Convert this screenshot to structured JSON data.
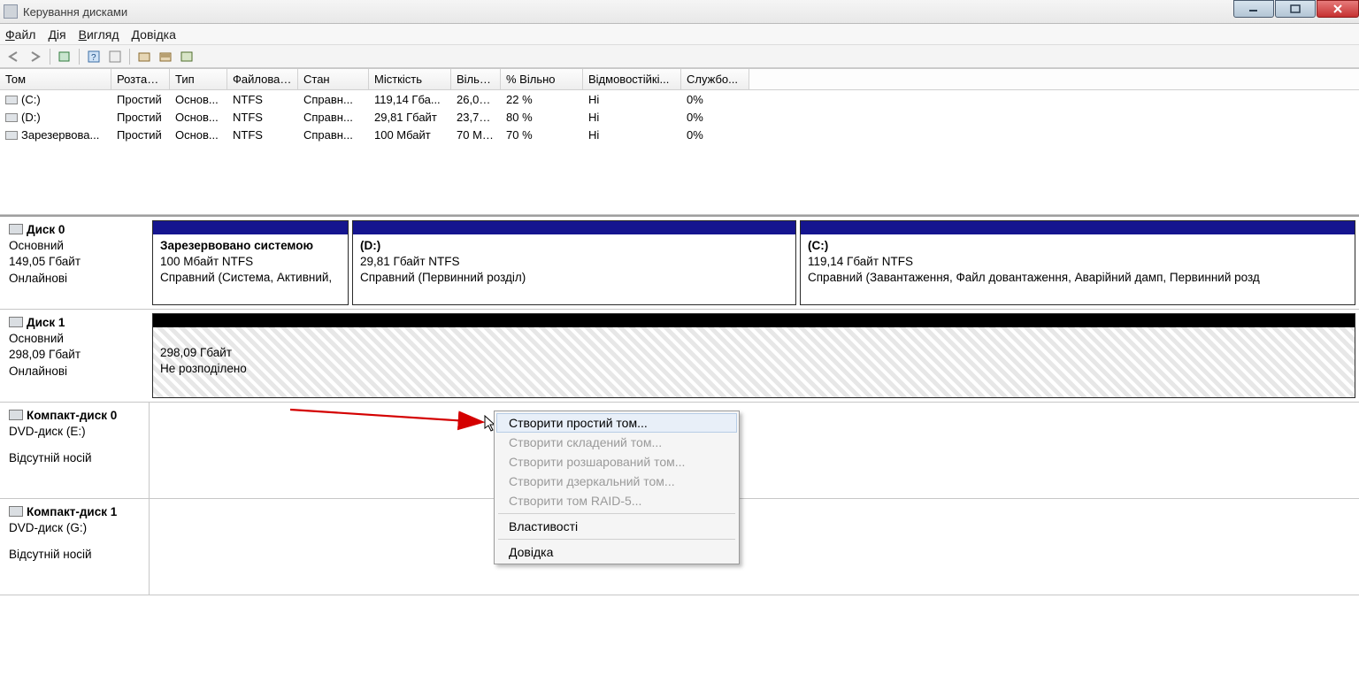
{
  "title": "Керування дисками",
  "menu": {
    "items": [
      "Файл",
      "Дія",
      "Вигляд",
      "Довідка"
    ]
  },
  "columns": [
    "Том",
    "Розташ...",
    "Тип",
    "Файлова ...",
    "Стан",
    "Місткість",
    "Вільн...",
    "% Вільно",
    "Відмовостійкі...",
    "Службо..."
  ],
  "volumes": [
    {
      "name": "(C:)",
      "layout": "Простий",
      "type": "Основ...",
      "fs": "NTFS",
      "status": "Справн...",
      "cap": "119,14 Гба...",
      "free": "26,02 ...",
      "pct": "22 %",
      "fault": "Ні",
      "ovh": "0%"
    },
    {
      "name": "(D:)",
      "layout": "Простий",
      "type": "Основ...",
      "fs": "NTFS",
      "status": "Справн...",
      "cap": "29,81 Гбайт",
      "free": "23,72 ...",
      "pct": "80 %",
      "fault": "Ні",
      "ovh": "0%"
    },
    {
      "name": "Зарезервова...",
      "layout": "Простий",
      "type": "Основ...",
      "fs": "NTFS",
      "status": "Справн...",
      "cap": "100 Мбайт",
      "free": "70 Мб...",
      "pct": "70 %",
      "fault": "Ні",
      "ovh": "0%"
    }
  ],
  "disks": [
    {
      "name": "Диск 0",
      "type": "Основний",
      "size": "149,05 Гбайт",
      "state": "Онлайнові",
      "parts": [
        {
          "kind": "vol",
          "title": "Зарезервовано системою",
          "line2": "100 Мбайт NTFS",
          "line3": "Справний (Система, Активний,",
          "flex": "0 0 222px"
        },
        {
          "kind": "vol",
          "title": "(D:)",
          "line2": "29,81 Гбайт NTFS",
          "line3": "Справний (Первинний розділ)",
          "flex": "0 0 502px"
        },
        {
          "kind": "vol",
          "title": "(C:)",
          "line2": "119,14 Гбайт NTFS",
          "line3": "Справний (Завантаження, Файл довантаження, Аварійний дамп, Первинний розд",
          "flex": "1"
        }
      ]
    },
    {
      "name": "Диск 1",
      "type": "Основний",
      "size": "298,09 Гбайт",
      "state": "Онлайнові",
      "parts": [
        {
          "kind": "unalloc",
          "title": "",
          "line2": "298,09 Гбайт",
          "line3": "Не розподілено",
          "flex": "1"
        }
      ]
    },
    {
      "name": "Компакт-диск 0",
      "type": "DVD-диск (E:)",
      "size": "",
      "state": "Відсутній носій",
      "parts": []
    },
    {
      "name": "Компакт-диск 1",
      "type": "DVD-диск (G:)",
      "size": "",
      "state": "Відсутній носій",
      "parts": []
    }
  ],
  "context": {
    "items": [
      {
        "label": "Створити простий том...",
        "enabled": true,
        "hl": true
      },
      {
        "label": "Створити складений том...",
        "enabled": false
      },
      {
        "label": "Створити розшарований том...",
        "enabled": false
      },
      {
        "label": "Створити дзеркальний том...",
        "enabled": false
      },
      {
        "label": "Створити том RAID-5...",
        "enabled": false
      },
      {
        "sep": true
      },
      {
        "label": "Властивості",
        "enabled": true
      },
      {
        "sep": true
      },
      {
        "label": "Довідка",
        "enabled": true
      }
    ]
  }
}
